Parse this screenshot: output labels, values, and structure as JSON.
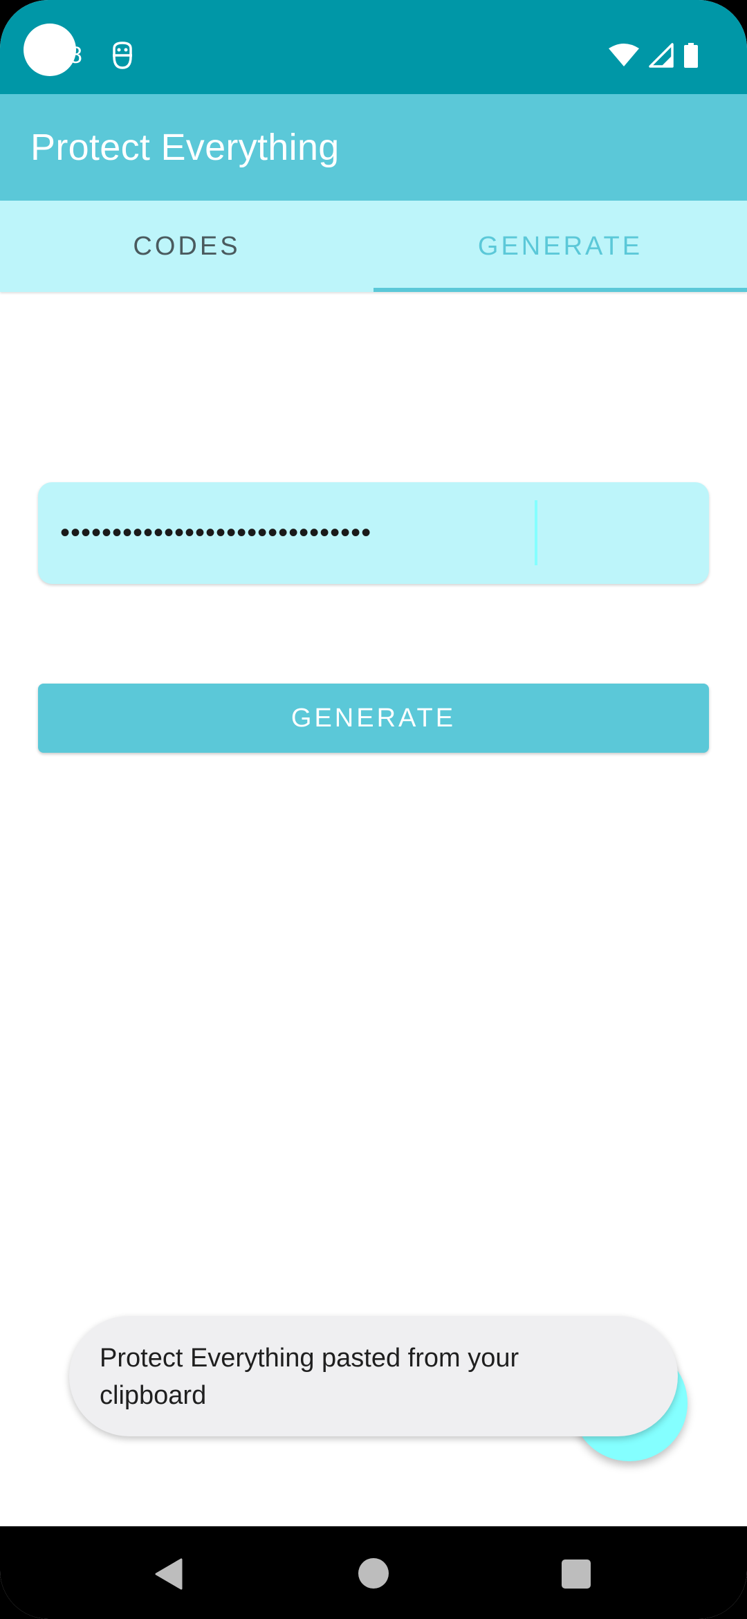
{
  "status_bar": {
    "time_fragment": "8",
    "icons": [
      "notification-app-icon",
      "wifi-icon",
      "signal-icon",
      "battery-icon"
    ]
  },
  "app_bar": {
    "title": "Protect Everything"
  },
  "tabs": [
    {
      "label": "CODES",
      "selected": false
    },
    {
      "label": "GENERATE",
      "selected": true
    }
  ],
  "password_field": {
    "value_masked": "••••••••••••••••••••••••••••••"
  },
  "generate_button": {
    "label": "GENERATE"
  },
  "toast": {
    "message": "Protect Everything pasted from your clipboard"
  },
  "nav_bar": {
    "icons": [
      "back-icon",
      "home-icon",
      "recents-icon"
    ]
  },
  "colors": {
    "status_bar": "#0097a7",
    "primary": "#5bc8d8",
    "tab_background": "#bdf5fa",
    "accent": "#84ffff"
  }
}
